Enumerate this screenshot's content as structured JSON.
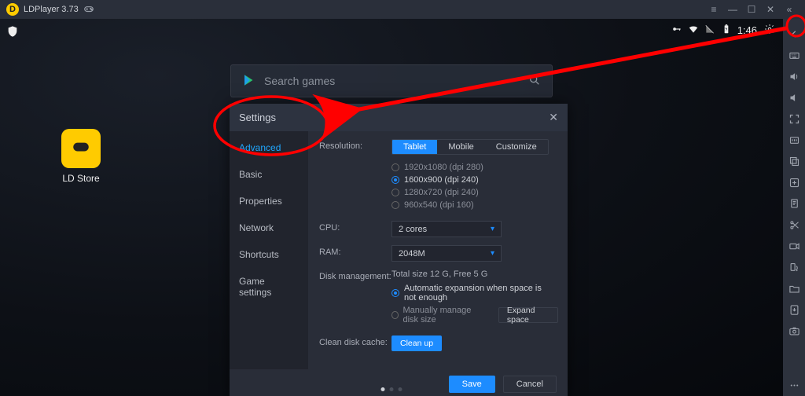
{
  "titlebar": {
    "app_name": "LDPlayer 3.73"
  },
  "statusbar": {
    "time": "1:46"
  },
  "desktop": {
    "ldstore_label": "LD Store"
  },
  "search": {
    "placeholder": "Search games"
  },
  "settings": {
    "title": "Settings",
    "sidebar": {
      "advanced": "Advanced",
      "basic": "Basic",
      "properties": "Properties",
      "network": "Network",
      "shortcuts": "Shortcuts",
      "game_settings": "Game settings"
    },
    "labels": {
      "resolution": "Resolution:",
      "cpu": "CPU:",
      "ram": "RAM:",
      "disk_management": "Disk management:",
      "clean_disk_cache": "Clean disk cache:"
    },
    "resolution_tabs": {
      "tablet": "Tablet",
      "mobile": "Mobile",
      "customize": "Customize"
    },
    "resolution_options": {
      "r1": "1920x1080  (dpi 280)",
      "r2": "1600x900  (dpi 240)",
      "r3": "1280x720  (dpi 240)",
      "r4": "960x540  (dpi 160)"
    },
    "cpu_value": "2 cores",
    "ram_value": "2048M",
    "disk_total_line": "Total size 12 G,   Free 5 G",
    "disk_options": {
      "auto": "Automatic expansion when space is not enough",
      "manual": "Manually manage disk size"
    },
    "buttons": {
      "expand": "Expand space",
      "cleanup": "Clean up",
      "save": "Save",
      "cancel": "Cancel"
    }
  },
  "accent_color": "#1d8cff"
}
